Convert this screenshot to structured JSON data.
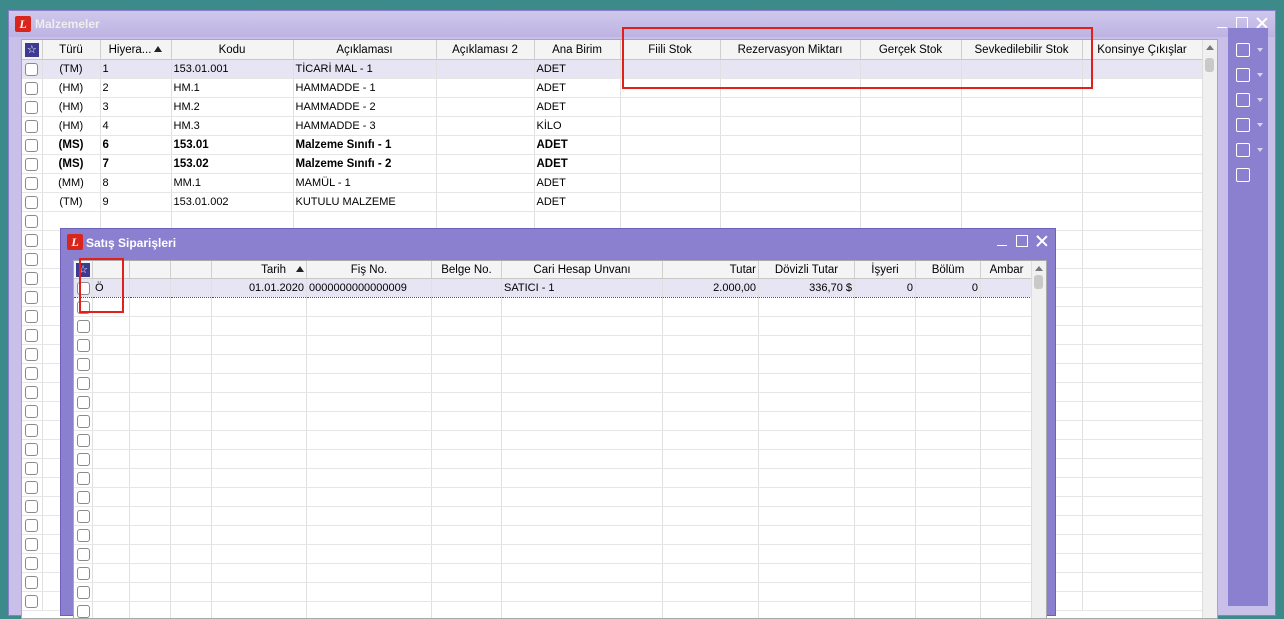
{
  "main": {
    "title": "Malzemeler",
    "columns": [
      "Türü",
      "Hiyera...",
      "Kodu",
      "Açıklaması",
      "Açıklaması 2",
      "Ana Birim",
      "Fiili Stok",
      "Rezervasyon Miktarı",
      "Gerçek Stok",
      "Sevkedilebilir Stok",
      "Konsinye Çıkışlar"
    ],
    "rows": [
      {
        "turu": "(TM)",
        "hiy": "1",
        "kodu": "153.01.001",
        "acik": "TİCARİ MAL - 1",
        "birim": "ADET",
        "bold": false,
        "selected": true
      },
      {
        "turu": "(HM)",
        "hiy": "2",
        "kodu": "HM.1",
        "acik": "HAMMADDE - 1",
        "birim": "ADET",
        "bold": false,
        "selected": false
      },
      {
        "turu": "(HM)",
        "hiy": "3",
        "kodu": "HM.2",
        "acik": "HAMMADDE - 2",
        "birim": "ADET",
        "bold": false,
        "selected": false
      },
      {
        "turu": "(HM)",
        "hiy": "4",
        "kodu": "HM.3",
        "acik": "HAMMADDE - 3",
        "birim": "KİLO",
        "bold": false,
        "selected": false
      },
      {
        "turu": "(MS)",
        "hiy": "6",
        "kodu": "153.01",
        "acik": "Malzeme Sınıfı - 1",
        "birim": "ADET",
        "bold": true,
        "selected": false
      },
      {
        "turu": "(MS)",
        "hiy": "7",
        "kodu": "153.02",
        "acik": "Malzeme Sınıfı - 2",
        "birim": "ADET",
        "bold": true,
        "selected": false
      },
      {
        "turu": "(MM)",
        "hiy": "8",
        "kodu": "MM.1",
        "acik": "MAMÜL - 1",
        "birim": "ADET",
        "bold": false,
        "selected": false
      },
      {
        "turu": "(TM)",
        "hiy": "9",
        "kodu": "153.01.002",
        "acik": "KUTULU MALZEME",
        "birim": "ADET",
        "bold": false,
        "selected": false
      }
    ],
    "toolbar_icons": [
      "basket-icon",
      "document-icon",
      "edit-note-icon",
      "tools-icon",
      "list-icon",
      "magic-wand-icon"
    ]
  },
  "sub": {
    "title": "Satış Siparişleri",
    "columns": [
      "",
      "",
      "",
      "Tarih",
      "Fiş No.",
      "Belge No.",
      "Cari Hesap Unvanı",
      "Tutar",
      "Dövizli Tutar",
      "İşyeri",
      "Bölüm",
      "Ambar"
    ],
    "rows": [
      {
        "status": "Ö",
        "tarih": "01.01.2020",
        "fis": "0000000000000009",
        "belge": "",
        "cari": "SATICI - 1",
        "tutar": "2.000,00",
        "doviz": "336,70 $",
        "isyeri": "0",
        "bolum": "0",
        "ambar": ""
      }
    ]
  },
  "colors": {
    "accent": "#8b7fd0",
    "highlight": "#e0201a",
    "selection": "#e7e4f3"
  }
}
